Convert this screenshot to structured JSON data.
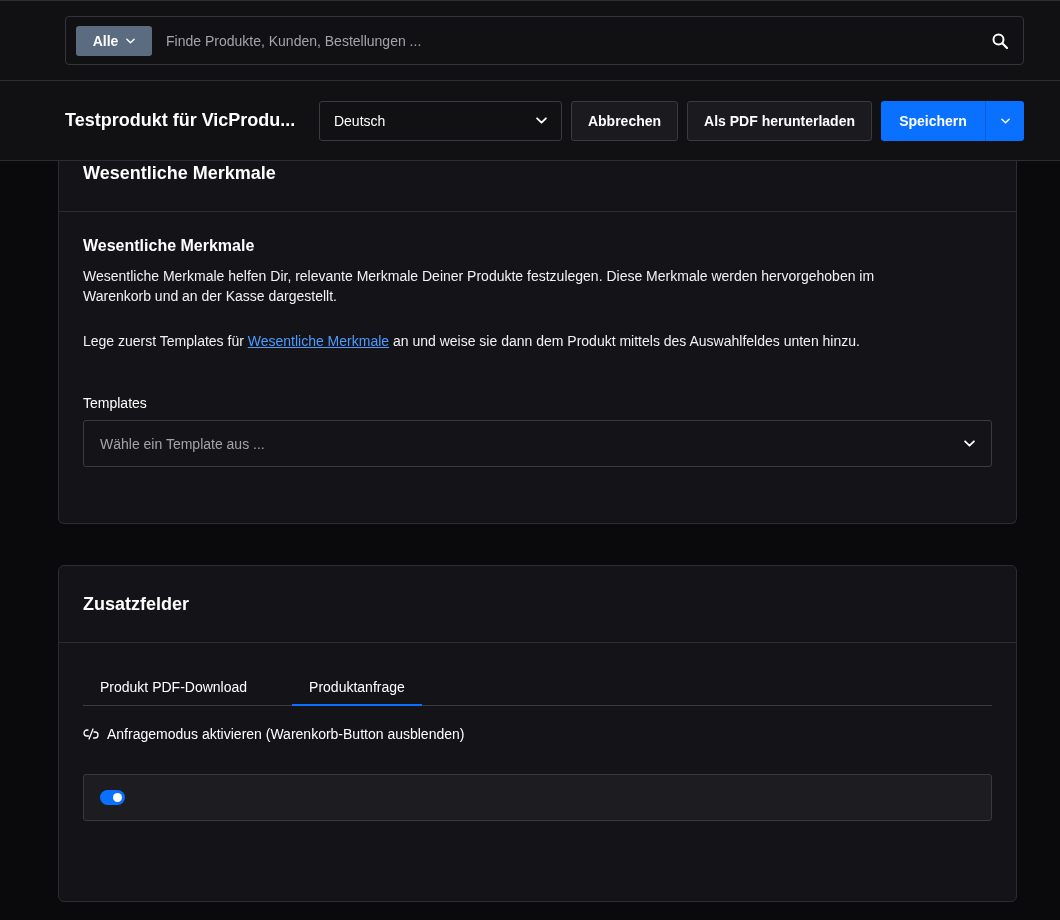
{
  "search": {
    "scope": "Alle",
    "placeholder": "Finde Produkte, Kunden, Bestellungen ..."
  },
  "header": {
    "title": "Testprodukt für VicProdu...",
    "language": "Deutsch",
    "buttons": [
      {
        "label": "Abbrechen",
        "kind": "secondary"
      },
      {
        "label": "Als PDF herunterladen",
        "kind": "secondary"
      },
      {
        "label": "Speichern",
        "kind": "primary"
      }
    ]
  },
  "essential_features": {
    "title": "Wesentliche Merkmale",
    "subtitle": "Wesentliche Merkmale",
    "description": "Wesentliche Merkmale helfen Dir, relevante Merkmale Deiner Produkte festzulegen. Diese Merkmale werden hervorgehoben im Warenkorb und an der Kasse dargestellt.",
    "hint_before": "Lege zuerst Templates für",
    "hint_link": "Wesentliche Merkmale",
    "hint_after": "an und weise sie dann dem Produkt mittels des Auswahlfeldes unten hinzu.",
    "templates_field": {
      "label": "Templates",
      "placeholder": "Wähle ein Template aus ..."
    }
  },
  "extra_fields": {
    "title": "Zusatzfelder",
    "tabs": [
      {
        "label": "Produkt PDF-Download",
        "selected": false
      },
      {
        "label": "Produktanfrage",
        "selected": true
      }
    ],
    "inquiry_mode": {
      "label": "Anfragemodus aktivieren (Warenkorb-Button ausblenden)",
      "on": true
    }
  }
}
